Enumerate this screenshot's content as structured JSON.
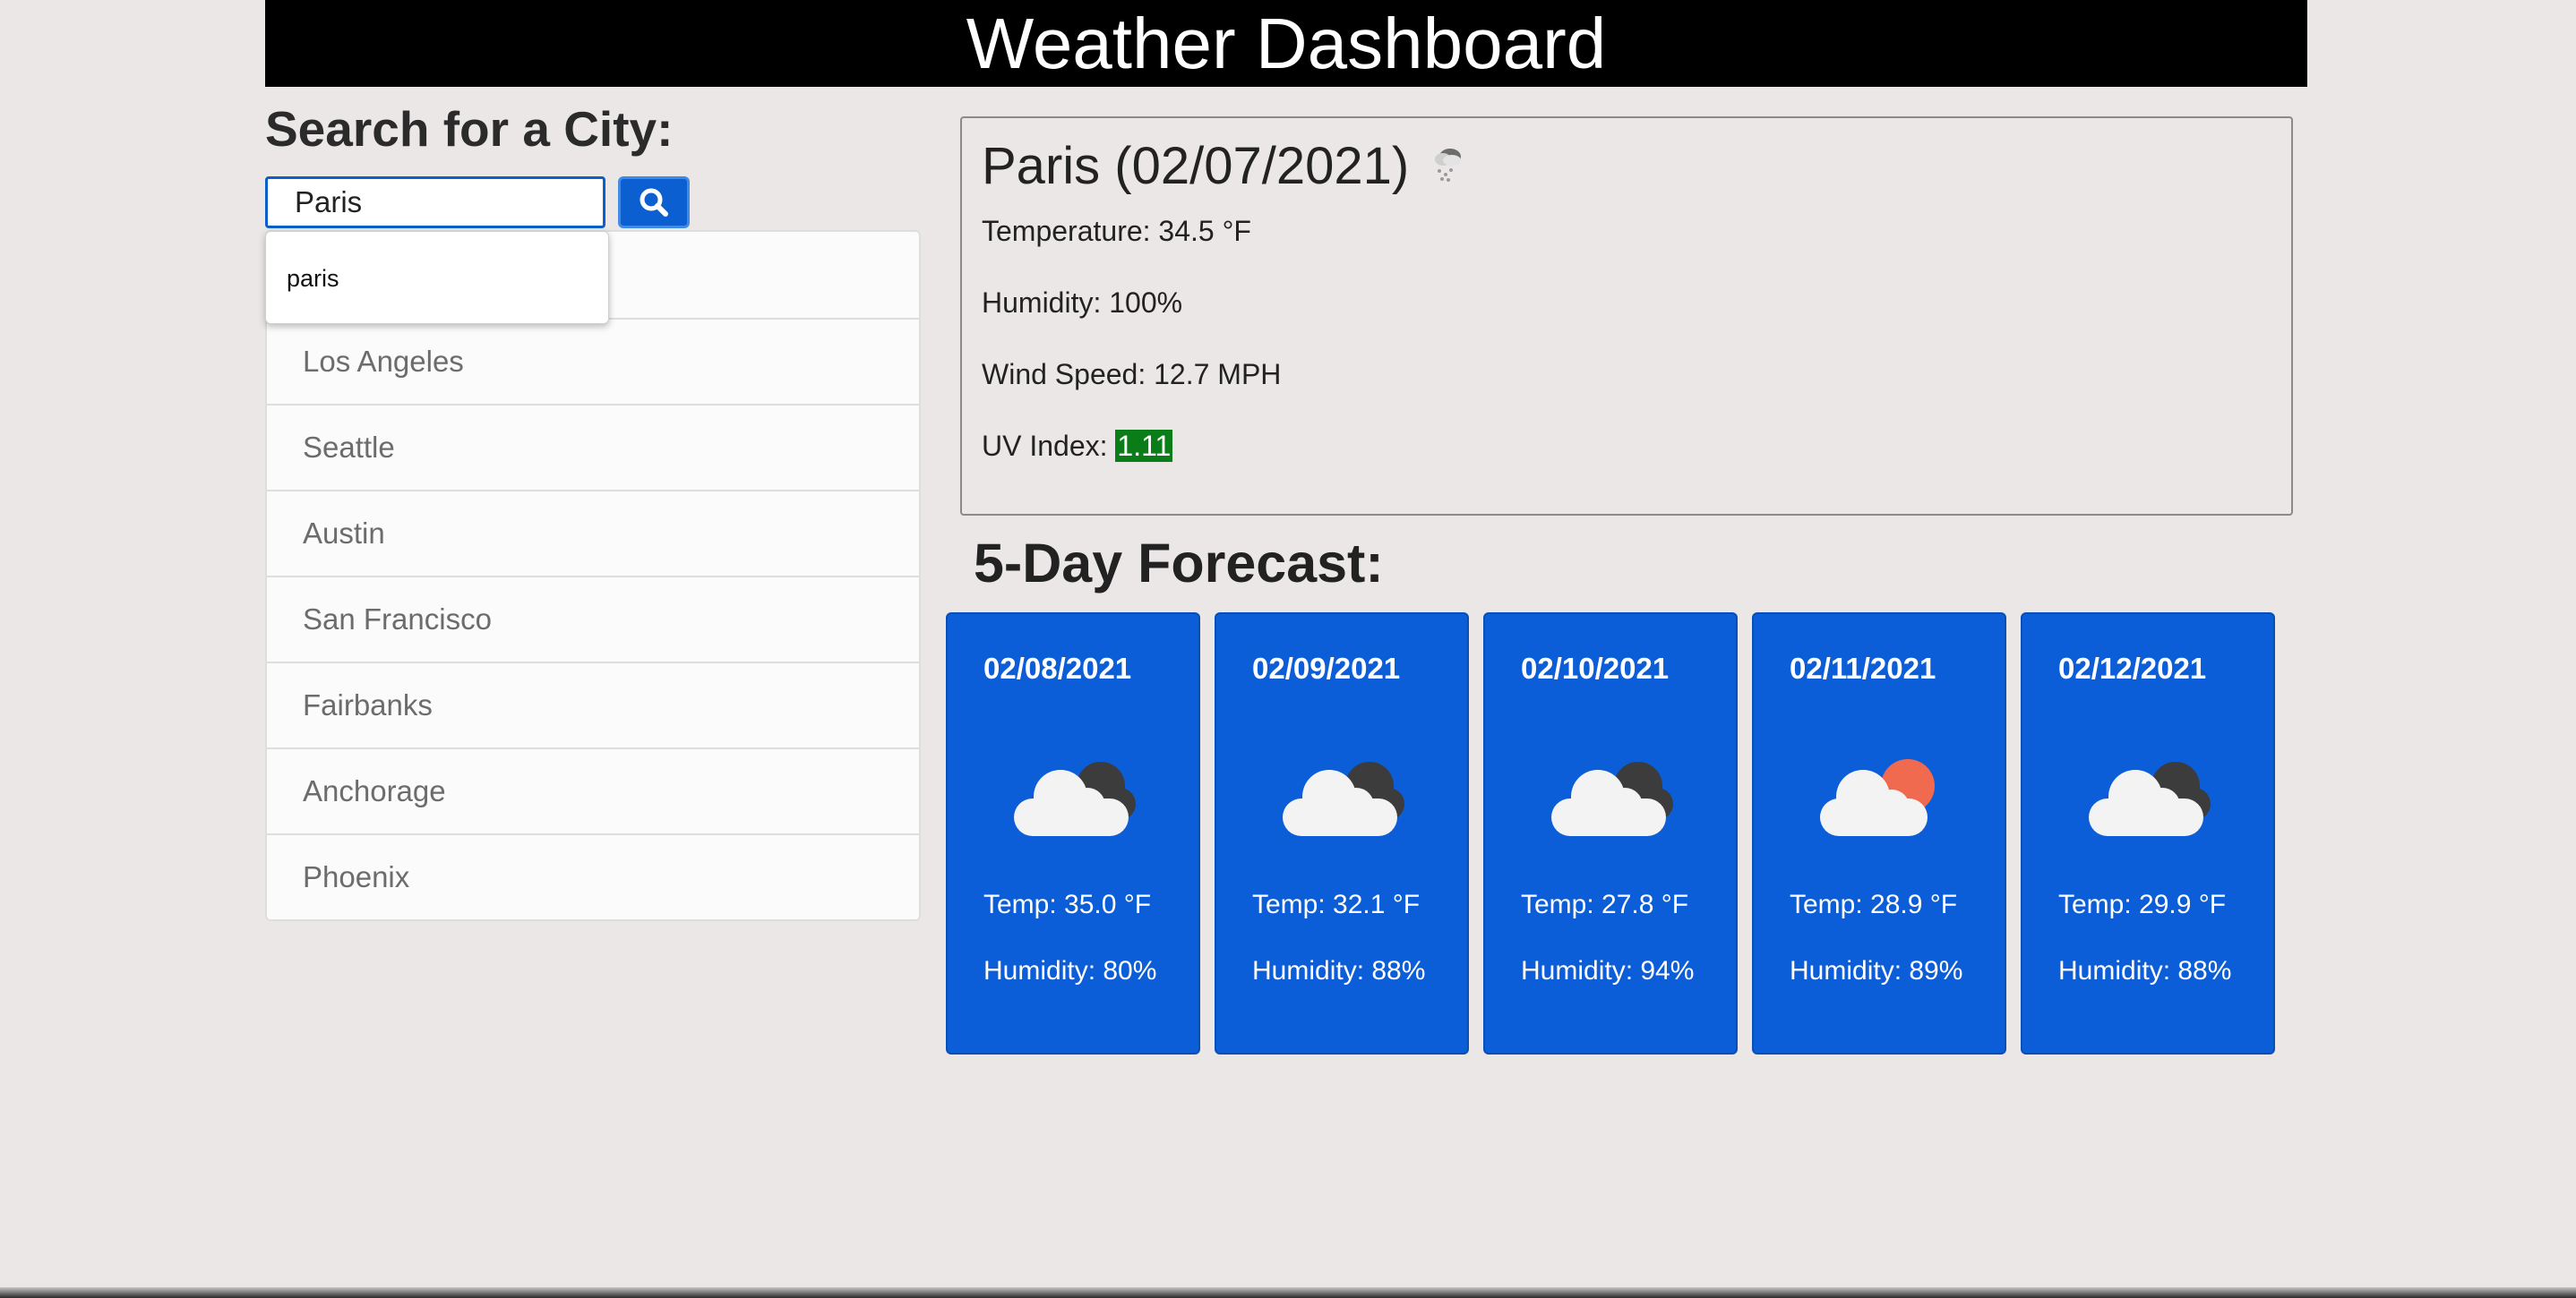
{
  "header": {
    "title": "Weather Dashboard"
  },
  "search": {
    "title": "Search for a City:",
    "input_value": "Paris",
    "button_icon": "search-icon",
    "autocomplete": [
      "paris"
    ]
  },
  "history": {
    "cities": [
      "",
      "Los Angeles",
      "Seattle",
      "Austin",
      "San Francisco",
      "Fairbanks",
      "Anchorage",
      "Phoenix"
    ]
  },
  "current": {
    "title": "Paris (02/07/2021)",
    "icon": "light-snow-icon",
    "temperature": "Temperature: 34.5 °F",
    "humidity": "Humidity: 100%",
    "wind": "Wind Speed: 12.7 MPH",
    "uv_label": "UV Index: ",
    "uv_value": "1.11"
  },
  "forecast": {
    "title": "5-Day Forecast:",
    "days": [
      {
        "date": "02/08/2021",
        "icon": "cloudy-night-icon",
        "temp": "Temp: 35.0 °F",
        "humidity": "Humidity: 80%"
      },
      {
        "date": "02/09/2021",
        "icon": "cloudy-night-icon",
        "temp": "Temp: 32.1 °F",
        "humidity": "Humidity: 88%"
      },
      {
        "date": "02/10/2021",
        "icon": "cloudy-night-icon",
        "temp": "Temp: 27.8 °F",
        "humidity": "Humidity: 94%"
      },
      {
        "date": "02/11/2021",
        "icon": "partly-cloudy-day-icon",
        "temp": "Temp: 28.9 °F",
        "humidity": "Humidity: 89%"
      },
      {
        "date": "02/12/2021",
        "icon": "cloudy-night-icon",
        "temp": "Temp: 29.9 °F",
        "humidity": "Humidity: 88%"
      }
    ]
  },
  "colors": {
    "accent": "#0b5ed7",
    "uv_low": "#0b7d18",
    "background": "#ebe7e7",
    "header": "#000000"
  }
}
